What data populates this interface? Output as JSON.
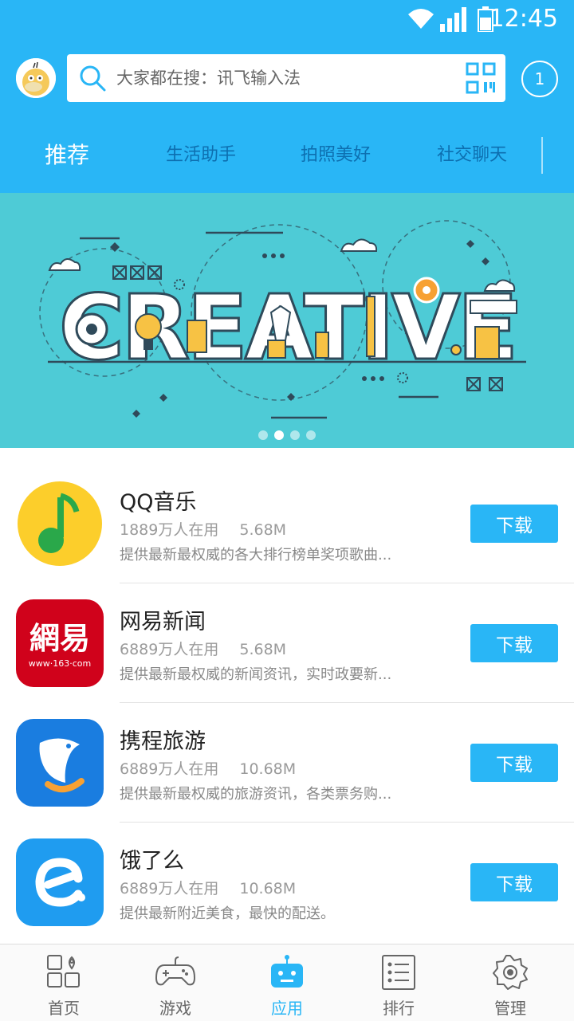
{
  "status": {
    "time": "12:45"
  },
  "search": {
    "placeholder": "大家都在搜：讯飞输入法"
  },
  "notifications": {
    "count": "1"
  },
  "tabs": [
    {
      "label": "推荐",
      "active": true
    },
    {
      "label": "生活助手"
    },
    {
      "label": "拍照美好"
    },
    {
      "label": "社交聊天"
    }
  ],
  "banner": {
    "text": "CREATIVE",
    "slides": 4,
    "current_slide": 2
  },
  "apps": [
    {
      "name": "QQ音乐",
      "users": "1889万人在用",
      "size": "5.68M",
      "desc": "提供最新最权威的各大排行榜单奖项歌曲...",
      "button": "下载"
    },
    {
      "name": "网易新闻",
      "users": "6889万人在用",
      "size": "5.68M",
      "desc": "提供最新最权威的新闻资讯，实时政要新...",
      "button": "下载",
      "icon_text": "網易",
      "icon_sub": "www·163·com"
    },
    {
      "name": "携程旅游",
      "users": "6889万人在用",
      "size": "10.68M",
      "desc": "提供最新最权威的旅游资讯，各类票务购...",
      "button": "下载"
    },
    {
      "name": "饿了么",
      "users": "6889万人在用",
      "size": "10.68M",
      "desc": "提供最新附近美食，最快的配送。",
      "button": "下载"
    }
  ],
  "nav": [
    {
      "label": "首页",
      "icon": "home-grid-icon"
    },
    {
      "label": "游戏",
      "icon": "gamepad-icon"
    },
    {
      "label": "应用",
      "icon": "robot-icon",
      "active": true
    },
    {
      "label": "排行",
      "icon": "ranking-list-icon"
    },
    {
      "label": "管理",
      "icon": "gear-icon"
    }
  ],
  "colors": {
    "accent": "#29b6f6",
    "banner_bg": "#4ecbd6",
    "tab_inactive": "#0d6fb0"
  }
}
